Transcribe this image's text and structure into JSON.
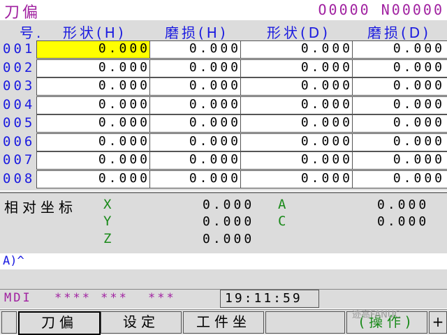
{
  "title": "刀偏",
  "program": "O0000 N00000",
  "headers": [
    "号.",
    "形状(H)",
    "磨损(H)",
    "形状(D)",
    "磨损(D)"
  ],
  "rows": [
    {
      "num": "001",
      "vals": [
        "0.000",
        "0.000",
        "0.000",
        "0.000"
      ]
    },
    {
      "num": "002",
      "vals": [
        "0.000",
        "0.000",
        "0.000",
        "0.000"
      ]
    },
    {
      "num": "003",
      "vals": [
        "0.000",
        "0.000",
        "0.000",
        "0.000"
      ]
    },
    {
      "num": "004",
      "vals": [
        "0.000",
        "0.000",
        "0.000",
        "0.000"
      ]
    },
    {
      "num": "005",
      "vals": [
        "0.000",
        "0.000",
        "0.000",
        "0.000"
      ]
    },
    {
      "num": "006",
      "vals": [
        "0.000",
        "0.000",
        "0.000",
        "0.000"
      ]
    },
    {
      "num": "007",
      "vals": [
        "0.000",
        "0.000",
        "0.000",
        "0.000"
      ]
    },
    {
      "num": "008",
      "vals": [
        "0.000",
        "0.000",
        "0.000",
        "0.000"
      ]
    }
  ],
  "coords": {
    "label": "相对坐标",
    "x": {
      "axis": "X",
      "value": "0.000"
    },
    "y": {
      "axis": "Y",
      "value": "0.000"
    },
    "z": {
      "axis": "Z",
      "value": "0.000"
    },
    "a": {
      "axis": "A",
      "value": "0.000"
    },
    "c": {
      "axis": "C",
      "value": "0.000"
    }
  },
  "input": "A)^",
  "status": {
    "mode": "MDI",
    "stars1": "**** ***",
    "stars2": "***",
    "time": "19:11:59"
  },
  "softkeys": {
    "left": "",
    "offset": "刀偏",
    "setting": "设定",
    "work": "工件坐",
    "blank": "",
    "operate": "(操作)",
    "plus": "+"
  },
  "watermark": "迹高FANUC",
  "colors": {
    "accent": "#a020a0",
    "header": "#1a1ae0",
    "axis": "#1a8a1a",
    "selected": "#ffff00"
  }
}
